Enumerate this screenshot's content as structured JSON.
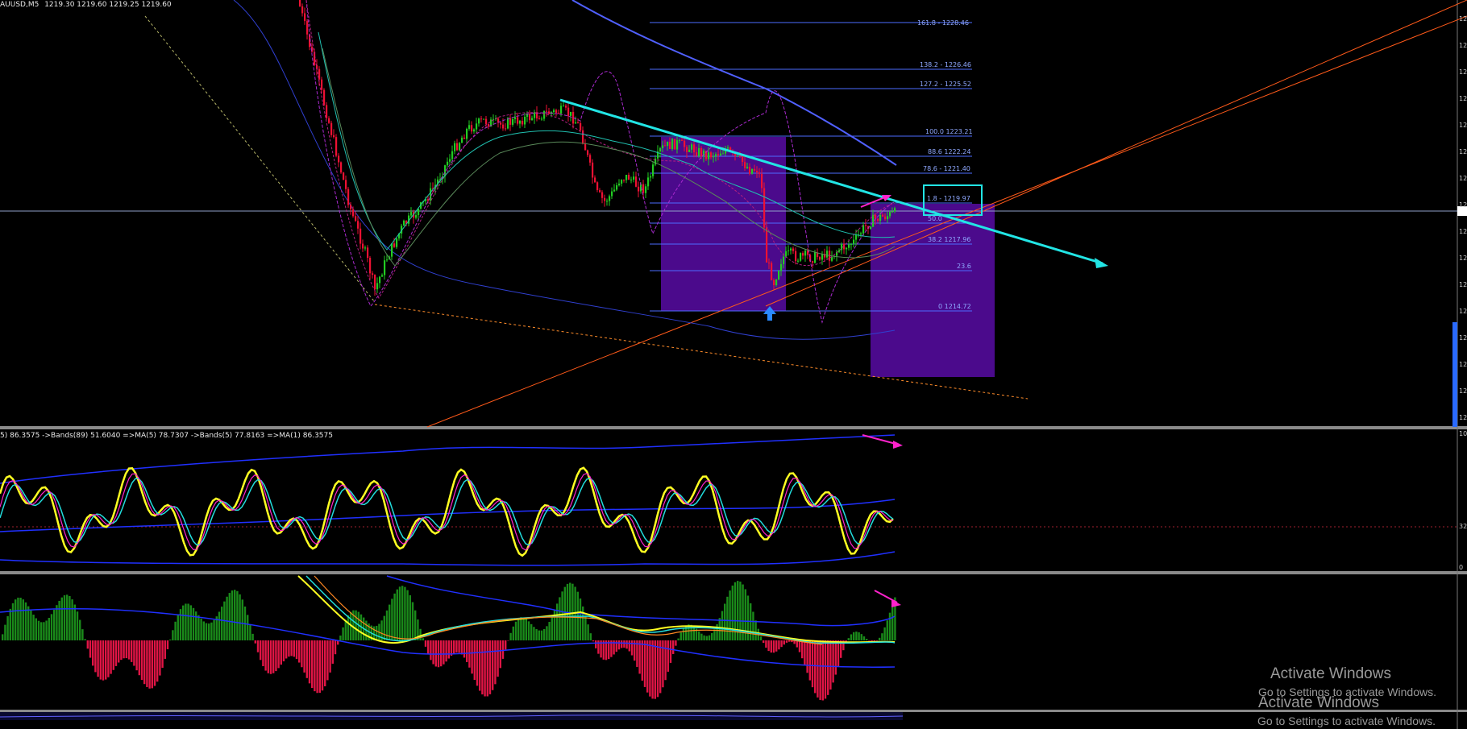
{
  "header": {
    "symbol_tf": "AUUSD,M5",
    "ohlc": "1219.30 1219.60 1219.25 1219.60"
  },
  "fib_levels": [
    {
      "label": "161.8 - 1228.46"
    },
    {
      "label": "138.2 - 1226.46"
    },
    {
      "label": "127.2 - 1225.52"
    },
    {
      "label": "100.0 1223.21"
    },
    {
      "label": "88.6 1222.24"
    },
    {
      "label": "78.6 - 1221.40"
    },
    {
      "label": "1.8 - 1219.97"
    },
    {
      "label": "50.0"
    },
    {
      "label": "38.2 1217.96"
    },
    {
      "label": "23.6"
    },
    {
      "label": "0 1214.72"
    }
  ],
  "indicator1": {
    "label": "5) 86.3575  ->Bands(89) 51.6040  =>MA(5) 78.7307  ->Bands(5) 77.8163  =>MA(1) 86.3575",
    "axis_top": "10",
    "axis_mid": "32",
    "axis_bottom": "0",
    "level_mid": "32"
  },
  "price_axis": {
    "label_prefix": "12"
  },
  "watermark": {
    "line1": "Activate Windows",
    "line2": "Go to Settings to activate Windows.",
    "line3": "Activate Windows",
    "line4": "Go to Settings to activate Windows."
  },
  "colors": {
    "background": "#000000",
    "bull": "#22cc22",
    "bear": "#ee1133",
    "cyan_trend": "#22e5e5",
    "magenta": "#ff22cc",
    "orange_channel": "#ff5a1a",
    "purple_box": "#4b0a8c",
    "fib_line": "#4c6cff",
    "yellow": "#ffff22"
  }
}
